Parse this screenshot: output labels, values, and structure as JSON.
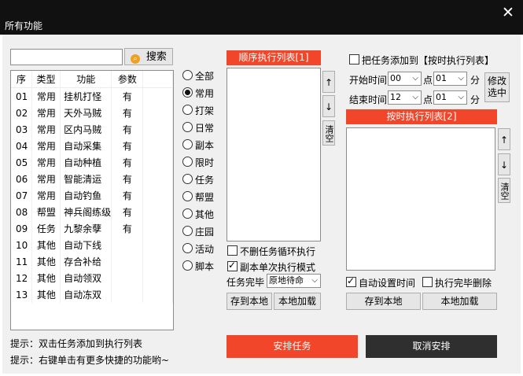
{
  "window": {
    "title": "所有功能",
    "close_icon": "close-icon"
  },
  "search": {
    "value": "",
    "button_label": "搜索",
    "icon": "search-icon"
  },
  "table": {
    "headers": [
      "序",
      "类型",
      "功能",
      "参数"
    ],
    "rows": [
      [
        "01",
        "常用",
        "挂机打怪",
        "有"
      ],
      [
        "02",
        "常用",
        "天外马贼",
        "有"
      ],
      [
        "03",
        "常用",
        "区内马贼",
        "有"
      ],
      [
        "04",
        "常用",
        "自动采集",
        "有"
      ],
      [
        "05",
        "常用",
        "自动种植",
        "有"
      ],
      [
        "06",
        "常用",
        "智能清运",
        "有"
      ],
      [
        "07",
        "常用",
        "自动钓鱼",
        "有"
      ],
      [
        "08",
        "帮盟",
        "神兵阁练级",
        "有"
      ],
      [
        "09",
        "任务",
        "九黎余孽",
        "有"
      ],
      [
        "10",
        "其他",
        "自动下线",
        ""
      ],
      [
        "11",
        "其他",
        "存合补给",
        ""
      ],
      [
        "12",
        "其他",
        "自动领双",
        ""
      ],
      [
        "13",
        "其他",
        "自动冻双",
        ""
      ]
    ]
  },
  "tips": {
    "tip1": "提示：双击任务添加到执行列表",
    "tip2": "提示：右键单击有更多快捷的功能哟~"
  },
  "filters": {
    "items": [
      "全部",
      "常用",
      "打架",
      "日常",
      "副本",
      "限时",
      "任务",
      "帮盟",
      "其他",
      "庄园",
      "活动",
      "脚本"
    ],
    "selected": "常用"
  },
  "sequence": {
    "header": "顺序执行列表[1]",
    "up": "↑",
    "down": "↓",
    "clear": "清空",
    "no_delete_loop": "不删任务循环执行",
    "no_delete_loop_checked": false,
    "dungeon_single": "副本单次执行模式",
    "dungeon_single_checked": true,
    "complete_label": "任务完毕",
    "complete_value": "原地待命",
    "save_label": "存到本地",
    "load_label": "本地加载"
  },
  "timed": {
    "add_label": "把任务添加到【按时执行列表】",
    "add_checked": false,
    "start_label": "开始时间",
    "start_hour": "00",
    "start_min": "01",
    "end_label": "结束时间",
    "end_hour": "12",
    "end_min": "01",
    "hour_unit": "点",
    "min_unit": "分",
    "modify_label_1": "修改",
    "modify_label_2": "选中",
    "header": "按时执行列表[2]",
    "up": "↑",
    "down": "↓",
    "clear": "清空",
    "auto_time": "自动设置时间",
    "auto_time_checked": true,
    "delete_done": "执行完毕删除",
    "delete_done_checked": false,
    "save_label": "存到本地",
    "load_label": "本地加载"
  },
  "footer": {
    "arrange_label": "安排任务",
    "cancel_label": "取消安排",
    "arrange_color": "#f2462a",
    "cancel_color": "#2f2f2f"
  }
}
